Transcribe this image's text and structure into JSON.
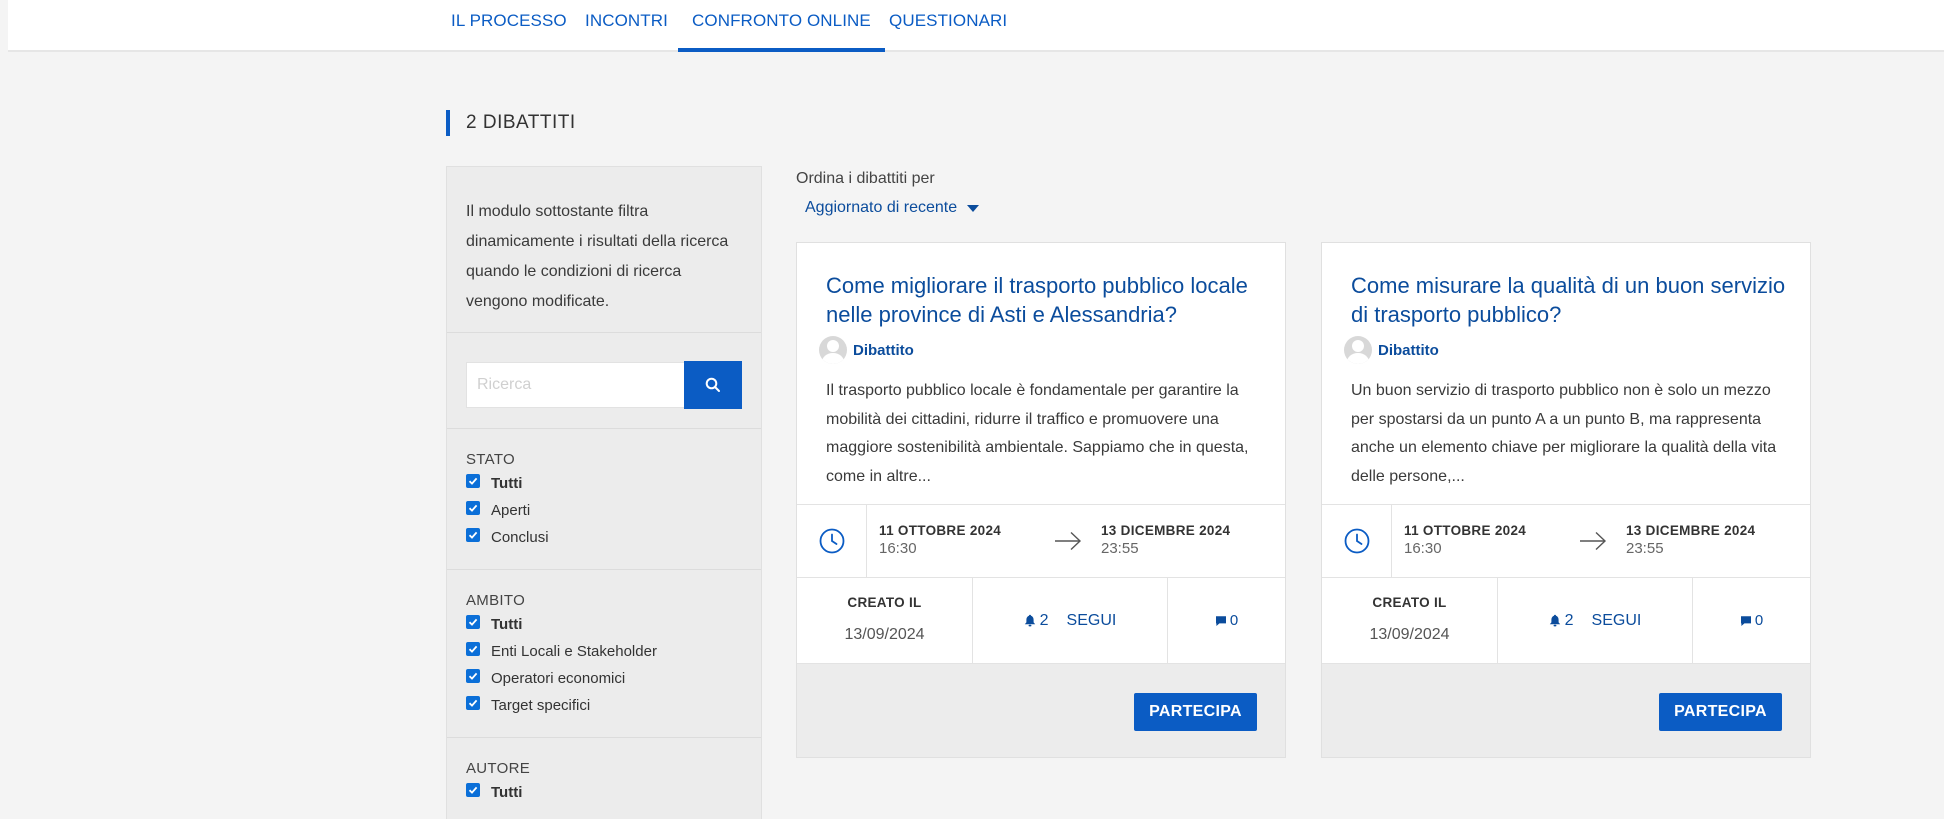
{
  "nav": {
    "tabs": [
      {
        "label": "IL PROCESSO"
      },
      {
        "label": "INCONTRI"
      },
      {
        "label": "CONFRONTO ONLINE"
      },
      {
        "label": "QUESTIONARI"
      }
    ]
  },
  "section": {
    "title": "2 DIBATTITI"
  },
  "sidebar": {
    "intro": "Il modulo sottostante filtra dinamicamente i risultati della ricerca quando le condizioni di ricerca vengono modificate.",
    "search": {
      "placeholder": "Ricerca",
      "button_icon": "search-icon"
    },
    "filters": [
      {
        "title": "STATO",
        "options": [
          {
            "label": "Tutti",
            "checked": true
          },
          {
            "label": "Aperti",
            "checked": true
          },
          {
            "label": "Conclusi",
            "checked": true
          }
        ]
      },
      {
        "title": "AMBITO",
        "options": [
          {
            "label": "Tutti",
            "checked": true
          },
          {
            "label": "Enti Locali e Stakeholder",
            "checked": true
          },
          {
            "label": "Operatori economici",
            "checked": true
          },
          {
            "label": "Target specifici",
            "checked": true
          }
        ]
      },
      {
        "title": "AUTORE",
        "options": [
          {
            "label": "Tutti",
            "checked": true
          }
        ]
      }
    ]
  },
  "sort": {
    "label": "Ordina i dibattiti per",
    "selected": "Aggiornato di recente"
  },
  "cards": [
    {
      "title": "Come migliorare il trasporto pubblico locale nelle province di Asti e Alessandria?",
      "type": "Dibattito",
      "description": "Il trasporto pubblico locale è fondamentale per garantire la mobilità dei cittadini, ridurre il traffico e promuovere una maggiore sostenibilità ambientale. Sappiamo che in questa, come in altre...",
      "start_date": "11 OTTOBRE 2024",
      "start_time": "16:30",
      "end_date": "13 DICEMBRE 2024",
      "end_time": "23:55",
      "created_label": "CREATO IL",
      "created_value": "13/09/2024",
      "followers": "2",
      "follow_label": "SEGUI",
      "comments": "0",
      "cta": "PARTECIPA"
    },
    {
      "title": "Come misurare la qualità di un buon servizio di trasporto pubblico?",
      "type": "Dibattito",
      "description": "Un buon servizio di trasporto pubblico non è solo un mezzo per spostarsi da un punto A a un punto B, ma rappresenta anche un elemento chiave per migliorare la qualità della vita delle persone,...",
      "start_date": "11 OTTOBRE 2024",
      "start_time": "16:30",
      "end_date": "13 DICEMBRE 2024",
      "end_time": "23:55",
      "created_label": "CREATO IL",
      "created_value": "13/09/2024",
      "followers": "2",
      "follow_label": "SEGUI",
      "comments": "0",
      "cta": "PARTECIPA"
    }
  ],
  "colors": {
    "accent": "#0b5cc4",
    "link": "#0b4c9c",
    "background": "#f4f4f4"
  }
}
